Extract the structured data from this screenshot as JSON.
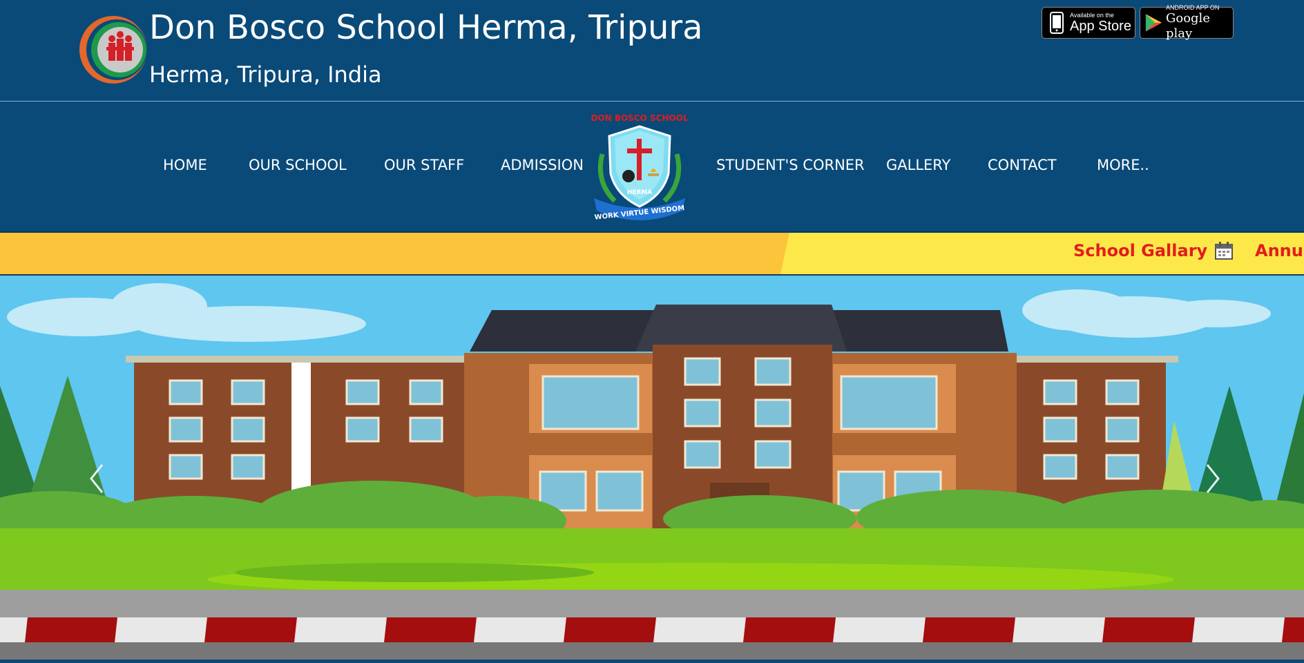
{
  "header": {
    "title": "Don Bosco School Herma, Tripura",
    "subtitle": "Herma, Tripura, India",
    "app_store": {
      "small": "Available on the",
      "big": "App Store"
    },
    "google_play": {
      "small": "ANDROID APP ON",
      "big": "Google play"
    }
  },
  "nav": {
    "items": [
      {
        "label": "HOME"
      },
      {
        "label": "OUR SCHOOL"
      },
      {
        "label": "OUR STAFF"
      },
      {
        "label": "ADMISSION"
      },
      {
        "label": "STUDENT'S CORNER"
      },
      {
        "label": "GALLERY"
      },
      {
        "label": "CONTACT"
      },
      {
        "label": "MORE.."
      }
    ],
    "crest": {
      "top_text": "DON BOSCO SCHOOL",
      "name_text": "HERMA",
      "motto": "WORK VIRTUE WISDOM"
    }
  },
  "ticker": {
    "items": [
      {
        "label": "School Gallary"
      },
      {
        "label": "Annua"
      }
    ],
    "icon": "calendar-icon"
  },
  "colors": {
    "header_bg": "#0a4a78",
    "ticker_left": "#fbc43a",
    "ticker_right": "#fde84a",
    "ticker_text": "#e31c1c"
  },
  "hero": {
    "icons": [
      "chevron-left-icon",
      "chevron-right-icon"
    ]
  }
}
